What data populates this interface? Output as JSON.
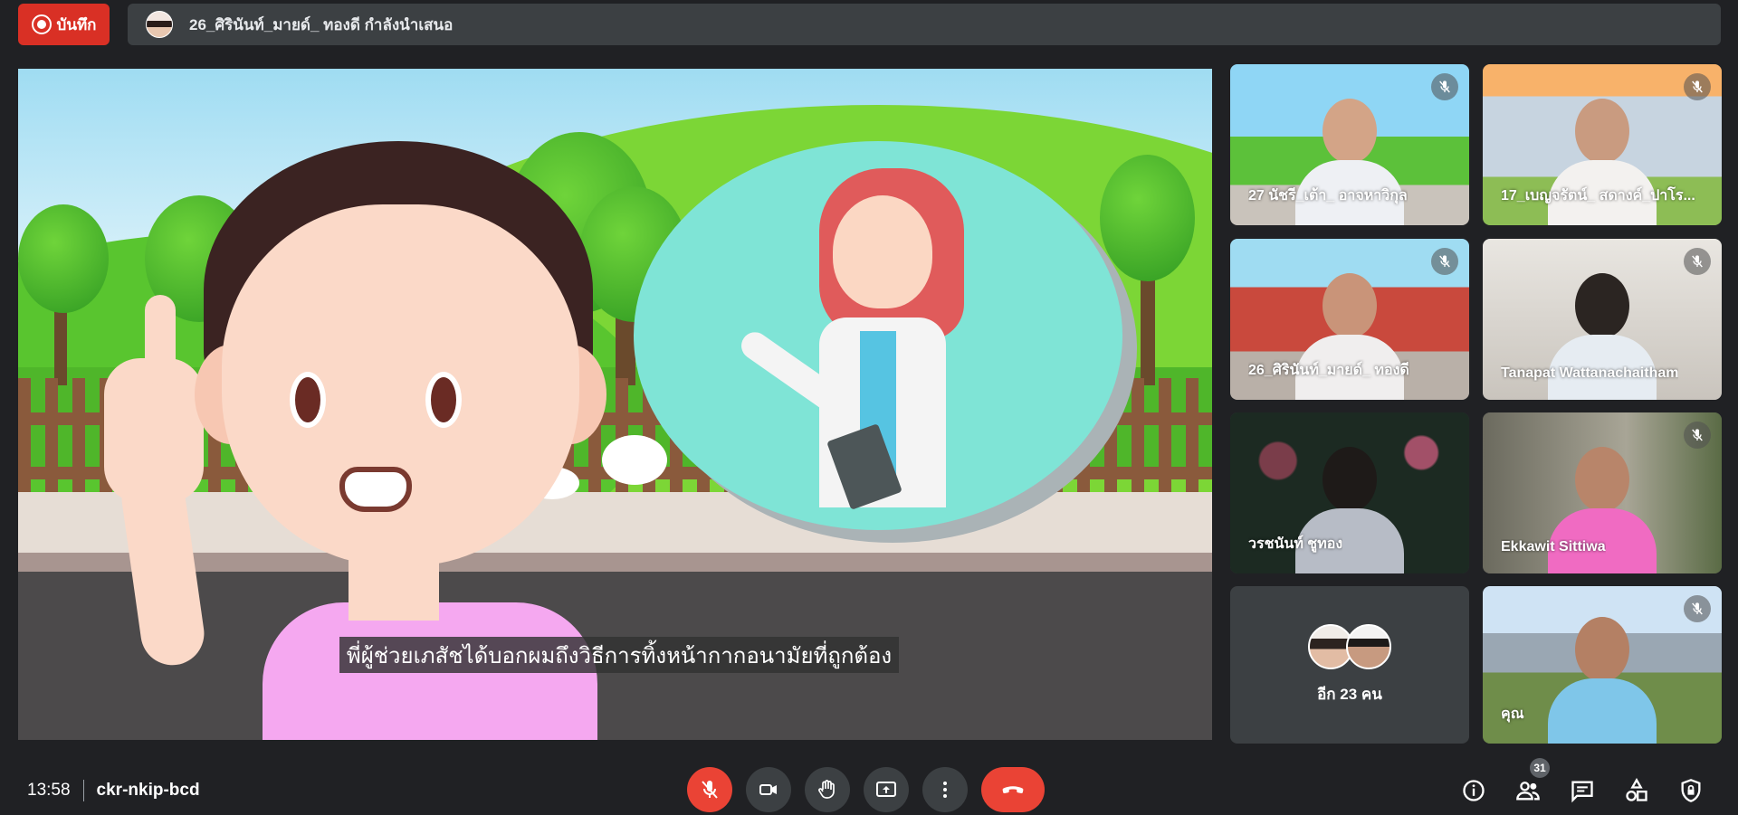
{
  "top_bar": {
    "record_label": "บันทึก",
    "presenter_text": "26_ศิรินันท์_มายด์_ ทองดี กำลังนำเสนอ"
  },
  "presentation": {
    "subtitle": "พี่ผู้ช่วยเภสัชได้บอกผมถึงวิธีการทิ้งหน้ากากอนามัยที่ถูกต้อง"
  },
  "participants": [
    {
      "name": "27 นัชรี_เต้า_ อาจหาวิกุล",
      "muted": true
    },
    {
      "name": "17_เบญจรัตน์_ สดางค์_ปาโร...",
      "muted": true
    },
    {
      "name": "26_ศิรินันท์_มายด์_ ทองดี",
      "muted": true
    },
    {
      "name": "Tanapat Wattanachaitham",
      "muted": true
    },
    {
      "name": "วรชนันท์ ชูทอง",
      "muted": false
    },
    {
      "name": "Ekkawit Sittiwa",
      "muted": true
    },
    {
      "name": "คุณ",
      "muted": true
    }
  ],
  "others_tile": {
    "label": "อีก 23 คน"
  },
  "bottom_bar": {
    "time": "13:58",
    "meeting_code": "ckr-nkip-bcd",
    "people_count": "31"
  },
  "colors": {
    "background": "#202124",
    "surface": "#3c4043",
    "danger": "#ea4335",
    "record": "#d93025"
  }
}
